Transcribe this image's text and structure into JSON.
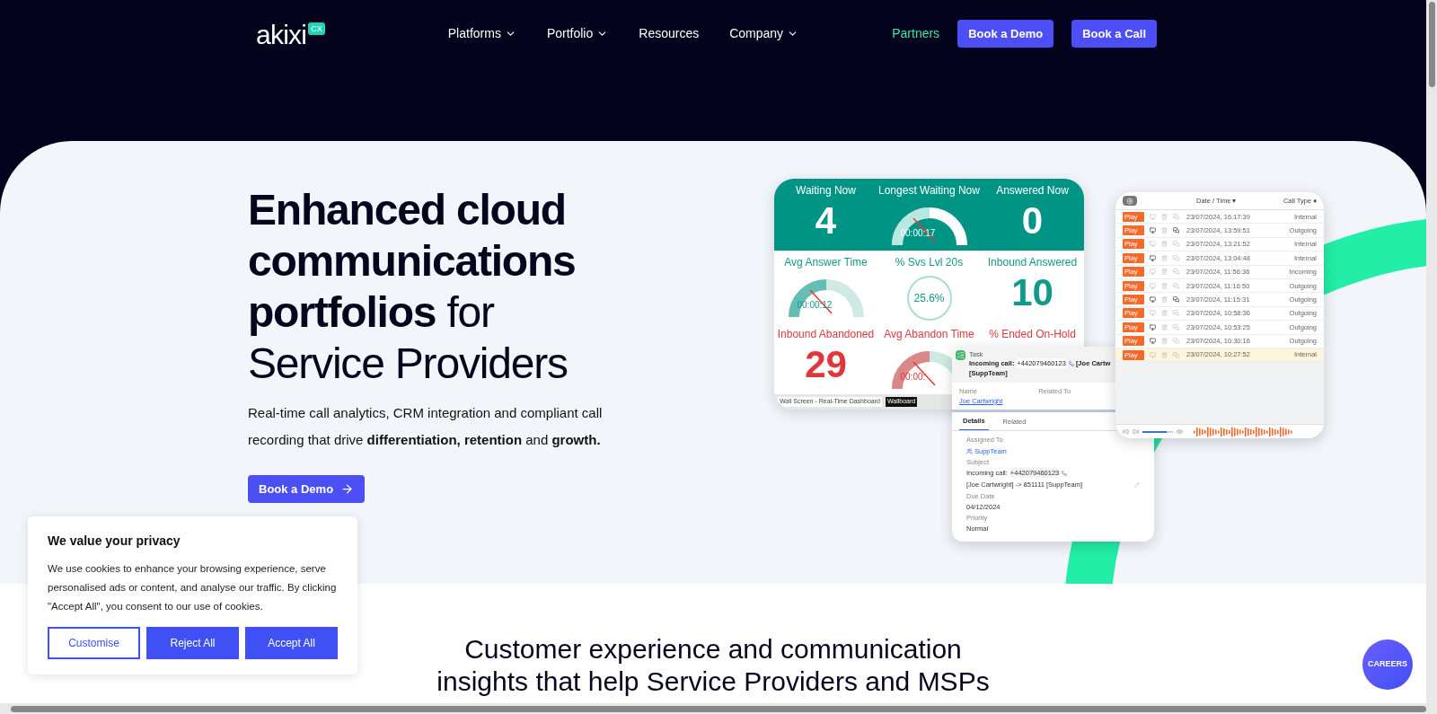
{
  "nav": {
    "logo": "akixi",
    "logo_badge": "CX",
    "items": [
      {
        "label": "Platforms",
        "dropdown": true
      },
      {
        "label": "Portfolio",
        "dropdown": true
      },
      {
        "label": "Resources",
        "dropdown": false
      },
      {
        "label": "Company",
        "dropdown": true
      }
    ],
    "partners": "Partners",
    "buttons": [
      "Book a Demo",
      "Book a Call"
    ]
  },
  "hero": {
    "heading_lines": [
      "**Enhanced cloud**",
      "**communications**",
      "**portfolios** for",
      "Service Providers"
    ],
    "text": "Real-time call analytics, CRM integration and compliant call recording that drive **differentiation, retention** and **growth.**",
    "cta": "Book a Demo"
  },
  "wallboard": {
    "tiles": [
      {
        "label": "Waiting Now",
        "value": "4",
        "kind": "number",
        "filled": true,
        "color": "#ffffff"
      },
      {
        "label": "Longest Waiting Now",
        "value": "00:00:17",
        "kind": "gauge",
        "filled": true,
        "color": "#ffffff"
      },
      {
        "label": "Answered Now",
        "value": "0",
        "kind": "number",
        "filled": true,
        "color": "#ffffff"
      },
      {
        "label": "Avg Answer Time",
        "value": "00:00:12",
        "kind": "gauge",
        "filled": false,
        "color": "#119a8b"
      },
      {
        "label": "% Svs Lvl 20s",
        "value": "25.6%",
        "kind": "ring",
        "filled": false,
        "color": "#119a8b"
      },
      {
        "label": "Inbound Answered",
        "value": "10",
        "kind": "number",
        "filled": false,
        "color": "#119a8b"
      },
      {
        "label": "Inbound Abandoned",
        "value": "29",
        "kind": "number",
        "filled": false,
        "color": "#e0383a"
      },
      {
        "label": "Avg Abandon Time",
        "value": "00:00:",
        "kind": "gauge",
        "filled": false,
        "color": "#e0383a"
      },
      {
        "label": "% Ended On-Hold",
        "kind": "number",
        "filled": false,
        "color": "#e0383a"
      }
    ],
    "footer_title": "Wall Screen - Real-Time Dashboard",
    "footer_tab": "Wallboard"
  },
  "call_list": {
    "columns": [
      "Date / Time ▾",
      "Call Type ♦"
    ],
    "rows": [
      {
        "play": "Play",
        "datetime": "23/07/2024, 16:17:39",
        "type": "Internal",
        "screen": false,
        "notes": false,
        "selected": false
      },
      {
        "play": "Play",
        "datetime": "23/07/2024, 13:59:51",
        "type": "Outgoing",
        "screen": true,
        "notes": true,
        "selected": false
      },
      {
        "play": "Play",
        "datetime": "23/07/2024, 13:21:52",
        "type": "Internal",
        "screen": false,
        "notes": false,
        "selected": false
      },
      {
        "play": "Play",
        "datetime": "23/07/2024, 13:04:48",
        "type": "Internal",
        "screen": true,
        "notes": false,
        "selected": false
      },
      {
        "play": "Play",
        "datetime": "23/07/2024, 11:56:36",
        "type": "Incoming",
        "screen": false,
        "notes": false,
        "selected": false
      },
      {
        "play": "Play",
        "datetime": "23/07/2024, 11:16:50",
        "type": "Outgoing",
        "screen": false,
        "notes": false,
        "selected": false
      },
      {
        "play": "Play",
        "datetime": "23/07/2024, 11:15:31",
        "type": "Outgoing",
        "screen": true,
        "notes": true,
        "selected": false
      },
      {
        "play": "Play",
        "datetime": "23/07/2024, 10:58:36",
        "type": "Outgoing",
        "screen": false,
        "notes": false,
        "selected": false
      },
      {
        "play": "Play",
        "datetime": "23/07/2024, 10:53:25",
        "type": "Outgoing",
        "screen": true,
        "notes": false,
        "selected": false
      },
      {
        "play": "Play",
        "datetime": "23/07/2024, 10:30:16",
        "type": "Outgoing",
        "screen": true,
        "notes": false,
        "selected": false
      },
      {
        "play": "Play",
        "datetime": "23/07/2024, 10:27:52",
        "type": "Internal",
        "screen": false,
        "notes": false,
        "selected": true
      }
    ],
    "player": {
      "level": 0.78
    }
  },
  "task": {
    "kind_label": "Task",
    "title_start": "Incoming call:",
    "title_number": "+442079460123",
    "title_rest": "[Joe Cartw",
    "title_line2": "[SuppTeam]",
    "name_label": "Name",
    "name": "Joe Cartwright",
    "related_label": "Related To",
    "tabs": [
      {
        "label": "Details",
        "selected": true
      },
      {
        "label": "Related",
        "selected": false
      }
    ],
    "assigned_label": "Assigned To",
    "assigned": "SuppTeam",
    "subject_label": "Subject",
    "subject_start": "Incoming call:",
    "subject_number": "+442079460123",
    "subject_rest": "[Joe Cartwright] -> 851111 [SuppTeam]",
    "due_label": "Due Date",
    "due": "04/12/2024",
    "priority_label": "Priority",
    "priority": "Normal"
  },
  "cookie": {
    "title": "We value your privacy",
    "text": "We use cookies to enhance your browsing experience, serve personalised ads or content, and analyse our traffic. By clicking \"Accept All\", you consent to our use of cookies.",
    "buttons": [
      {
        "label": "Customise",
        "kind": "outline"
      },
      {
        "label": "Reject All",
        "kind": "solid"
      },
      {
        "label": "Accept All",
        "kind": "solid"
      }
    ]
  },
  "section": {
    "heading": "Customer experience and communication insights that help Service Providers and MSPs"
  },
  "careers": "CAREERS"
}
